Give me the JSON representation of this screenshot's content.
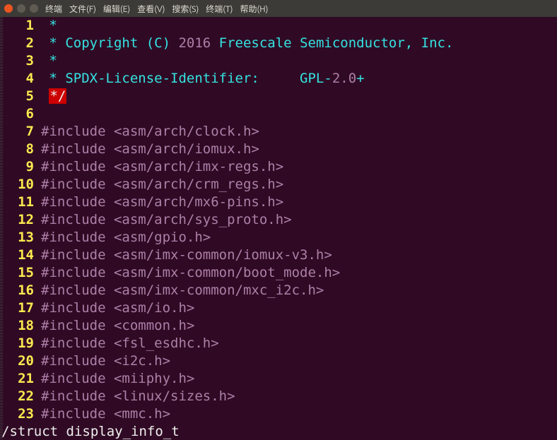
{
  "window": {
    "controls": {
      "close": "close",
      "min": "minimize",
      "max": "maximize"
    }
  },
  "menubar": {
    "items": [
      "终端",
      "文件(F)",
      "编辑(E)",
      "查看(V)",
      "搜索(S)",
      "终端(T)",
      "帮助(H)"
    ]
  },
  "code": {
    "lines": [
      {
        "n": "1",
        "segments": [
          {
            "cls": "c-comment",
            "t": " *"
          }
        ]
      },
      {
        "n": "2",
        "segments": [
          {
            "cls": "c-comment",
            "t": " * Copyright (C) "
          },
          {
            "cls": "c-number",
            "t": "2016"
          },
          {
            "cls": "c-comment",
            "t": " Freescale Semiconductor, Inc."
          }
        ]
      },
      {
        "n": "3",
        "segments": [
          {
            "cls": "c-comment",
            "t": " *"
          }
        ]
      },
      {
        "n": "4",
        "segments": [
          {
            "cls": "c-comment",
            "t": " * SPDX-License-Identifier:     GPL-"
          },
          {
            "cls": "c-number",
            "t": "2.0"
          },
          {
            "cls": "c-comment",
            "t": "+"
          }
        ]
      },
      {
        "n": "5",
        "segments": [
          {
            "cls": "c-comment",
            "t": " "
          },
          {
            "cls": "hl-block",
            "t": "*/"
          }
        ]
      },
      {
        "n": "6",
        "segments": []
      },
      {
        "n": "7",
        "segments": [
          {
            "cls": "c-preproc",
            "t": "#include "
          },
          {
            "cls": "c-string",
            "t": "<asm/arch/clock.h>"
          }
        ]
      },
      {
        "n": "8",
        "segments": [
          {
            "cls": "c-preproc",
            "t": "#include "
          },
          {
            "cls": "c-string",
            "t": "<asm/arch/iomux.h>"
          }
        ]
      },
      {
        "n": "9",
        "segments": [
          {
            "cls": "c-preproc",
            "t": "#include "
          },
          {
            "cls": "c-string",
            "t": "<asm/arch/imx-regs.h>"
          }
        ]
      },
      {
        "n": "10",
        "segments": [
          {
            "cls": "c-preproc",
            "t": "#include "
          },
          {
            "cls": "c-string",
            "t": "<asm/arch/crm_regs.h>"
          }
        ]
      },
      {
        "n": "11",
        "segments": [
          {
            "cls": "c-preproc",
            "t": "#include "
          },
          {
            "cls": "c-string",
            "t": "<asm/arch/mx6-pins.h>"
          }
        ]
      },
      {
        "n": "12",
        "segments": [
          {
            "cls": "c-preproc",
            "t": "#include "
          },
          {
            "cls": "c-string",
            "t": "<asm/arch/sys_proto.h>"
          }
        ]
      },
      {
        "n": "13",
        "segments": [
          {
            "cls": "c-preproc",
            "t": "#include "
          },
          {
            "cls": "c-string",
            "t": "<asm/gpio.h>"
          }
        ]
      },
      {
        "n": "14",
        "segments": [
          {
            "cls": "c-preproc",
            "t": "#include "
          },
          {
            "cls": "c-string",
            "t": "<asm/imx-common/iomux-v3.h>"
          }
        ]
      },
      {
        "n": "15",
        "segments": [
          {
            "cls": "c-preproc",
            "t": "#include "
          },
          {
            "cls": "c-string",
            "t": "<asm/imx-common/boot_mode.h>"
          }
        ]
      },
      {
        "n": "16",
        "segments": [
          {
            "cls": "c-preproc",
            "t": "#include "
          },
          {
            "cls": "c-string",
            "t": "<asm/imx-common/mxc_i2c.h>"
          }
        ]
      },
      {
        "n": "17",
        "segments": [
          {
            "cls": "c-preproc",
            "t": "#include "
          },
          {
            "cls": "c-string",
            "t": "<asm/io.h>"
          }
        ]
      },
      {
        "n": "18",
        "segments": [
          {
            "cls": "c-preproc",
            "t": "#include "
          },
          {
            "cls": "c-string",
            "t": "<common.h>"
          }
        ]
      },
      {
        "n": "19",
        "segments": [
          {
            "cls": "c-preproc",
            "t": "#include "
          },
          {
            "cls": "c-string",
            "t": "<fsl_esdhc.h>"
          }
        ]
      },
      {
        "n": "20",
        "segments": [
          {
            "cls": "c-preproc",
            "t": "#include "
          },
          {
            "cls": "c-string",
            "t": "<i2c.h>"
          }
        ]
      },
      {
        "n": "21",
        "segments": [
          {
            "cls": "c-preproc",
            "t": "#include "
          },
          {
            "cls": "c-string",
            "t": "<miiphy.h>"
          }
        ]
      },
      {
        "n": "22",
        "segments": [
          {
            "cls": "c-preproc",
            "t": "#include "
          },
          {
            "cls": "c-string",
            "t": "<linux/sizes.h>"
          }
        ]
      },
      {
        "n": "23",
        "segments": [
          {
            "cls": "c-preproc",
            "t": "#include "
          },
          {
            "cls": "c-string",
            "t": "<mmc.h>"
          }
        ]
      }
    ]
  },
  "cmdline": {
    "text": "/struct display_info_t"
  }
}
